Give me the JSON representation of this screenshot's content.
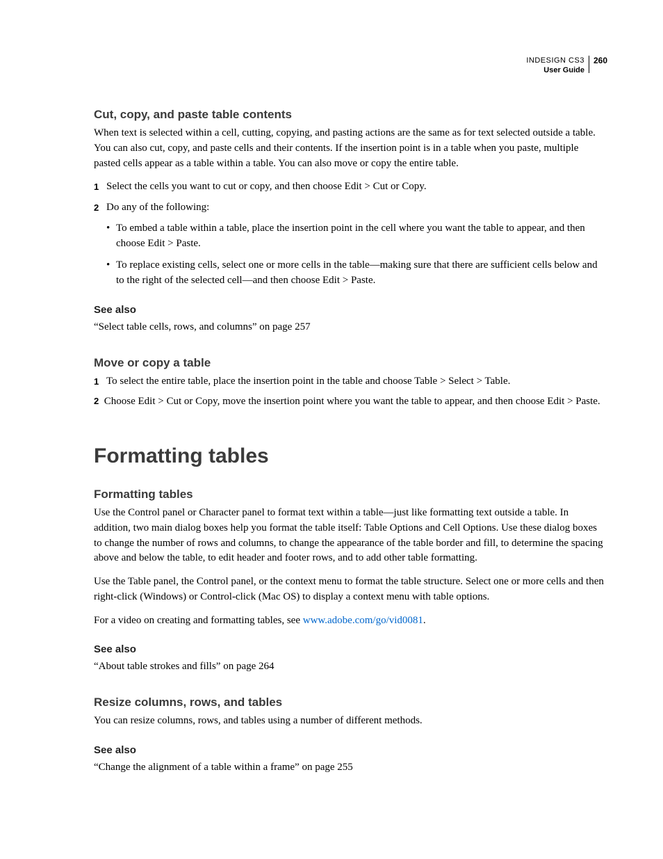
{
  "header": {
    "product": "INDESIGN CS3",
    "guide": "User Guide",
    "page": "260"
  },
  "s1": {
    "title": "Cut, copy, and paste table contents",
    "intro": "When text is selected within a cell, cutting, copying, and pasting actions are the same as for text selected outside a table. You can also cut, copy, and paste cells and their contents. If the insertion point is in a table when you paste, multiple pasted cells appear as a table within a table. You can also move or copy the entire table.",
    "step1_num": "1",
    "step1": "Select the cells you want to cut or copy, and then choose Edit > Cut or Copy.",
    "step2_num": "2",
    "step2": "Do any of the following:",
    "b1": "To embed a table within a table, place the insertion point in the cell where you want the table to appear, and then choose Edit > Paste.",
    "b2": "To replace existing cells, select one or more cells in the table—making sure that there are sufficient cells below and to the right of the selected cell—and then choose Edit > Paste.",
    "see_also": "See also",
    "see_ref": "“Select table cells, rows, and columns” on page 257"
  },
  "s2": {
    "title": "Move or copy a table",
    "step1_num": "1",
    "step1": "To select the entire table, place the insertion point in the table and choose Table > Select > Table.",
    "step2_num": "2",
    "step2": "Choose Edit > Cut or Copy, move the insertion point where you want the table to appear, and then choose Edit > Paste."
  },
  "major": {
    "title": "Formatting tables"
  },
  "s3": {
    "title": "Formatting tables",
    "p1": "Use the Control panel or Character panel to format text within a table—just like formatting text outside a table. In addition, two main dialog boxes help you format the table itself: Table Options and Cell Options. Use these dialog boxes to change the number of rows and columns, to change the appearance of the table border and fill, to determine the spacing above and below the table, to edit header and footer rows, and to add other table formatting.",
    "p2": "Use the Table panel, the Control panel, or the context menu to format the table structure. Select one or more cells and then right-click (Windows) or Control-click (Mac OS) to display a context menu with table options.",
    "p3_prefix": "For a video on creating and formatting tables, see ",
    "p3_link": "www.adobe.com/go/vid0081",
    "p3_suffix": ".",
    "see_also": "See also",
    "see_ref": "“About table strokes and fills” on page 264"
  },
  "s4": {
    "title": "Resize columns, rows, and tables",
    "p1": "You can resize columns, rows, and tables using a number of different methods.",
    "see_also": "See also",
    "see_ref": "“Change the alignment of a table within a frame” on page 255"
  }
}
